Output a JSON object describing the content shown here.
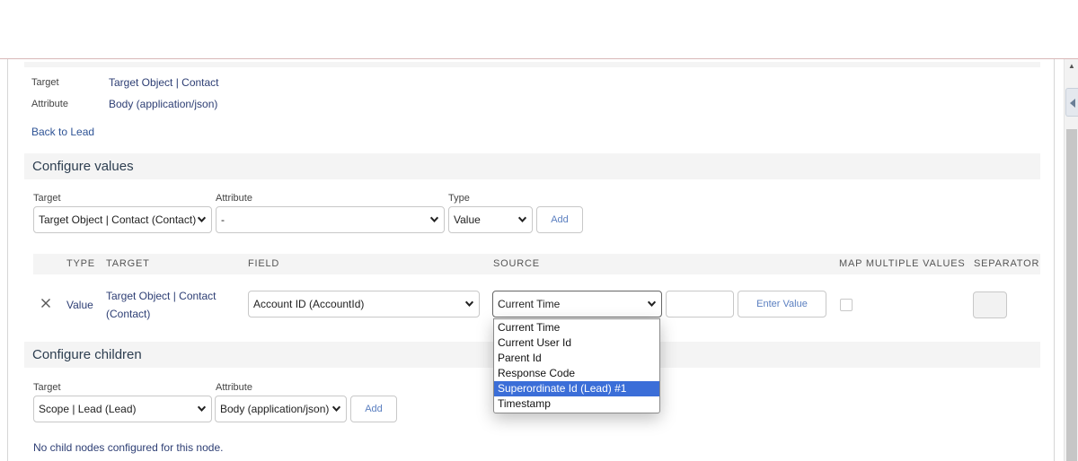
{
  "header": {
    "target_label": "Target",
    "target_value": "Target Object | Contact",
    "attribute_label": "Attribute",
    "attribute_value": "Body (application/json)",
    "back_link": "Back to Lead"
  },
  "configure_values": {
    "title": "Configure values",
    "target_label": "Target",
    "target_select": "Target Object | Contact (Contact)",
    "attribute_label": "Attribute",
    "attribute_select": "-",
    "type_label": "Type",
    "type_select": "Value",
    "add_label": "Add"
  },
  "values_table": {
    "columns": [
      "TYPE",
      "TARGET",
      "FIELD",
      "SOURCE",
      "MAP MULTIPLE VALUES",
      "SEPARATOR"
    ],
    "rows": [
      {
        "type": "Value",
        "target_line1": "Target Object | Contact",
        "target_line2": "(Contact)",
        "field": "Account ID (AccountId)",
        "source": "Current Time",
        "enter_value_label": "Enter Value",
        "map_multiple": false
      }
    ]
  },
  "source_dropdown": {
    "options": [
      "Current Time",
      "Current User Id",
      "Parent Id",
      "Response Code",
      "Superordinate Id (Lead) #1",
      "Timestamp"
    ],
    "highlighted": "Superordinate Id (Lead) #1"
  },
  "configure_children": {
    "title": "Configure children",
    "target_label": "Target",
    "target_select": "Scope | Lead (Lead)",
    "attribute_label": "Attribute",
    "attribute_select": "Body (application/json)",
    "add_label": "Add",
    "empty_message": "No child nodes configured for this node."
  },
  "colors": {
    "accent": "#2f5496",
    "selected_option": "#3b6ed8",
    "section_bg": "#f4f4f4"
  }
}
